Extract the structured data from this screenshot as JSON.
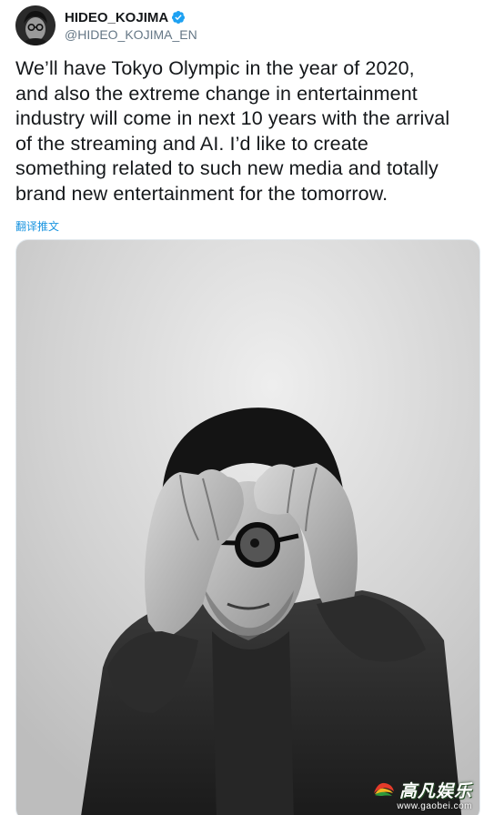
{
  "author": {
    "display_name": "HIDEO_KOJIMA",
    "handle": "@HIDEO_KOJIMA_EN",
    "verified": true,
    "icons": {
      "avatar": "avatar-photo",
      "verified": "verified-badge-icon"
    }
  },
  "tweet": {
    "text": "We’ll have Tokyo Olympic in the year of 2020,\nand also the extreme change in entertainment\nindustry will come in next 10 years with the arrival\nof the streaming and AI. I’d like to create\nsomething related to such new media and totally\nbrand new entertainment for the tomorrow.",
    "translate_label": "翻译推文"
  },
  "media": {
    "watermark_brand": "高凡娱乐",
    "watermark_url": "www.gaobei.com"
  },
  "colors": {
    "text": "#14171a",
    "secondary": "#657786",
    "link": "#1b95e0",
    "verified": "#1da1f2"
  }
}
